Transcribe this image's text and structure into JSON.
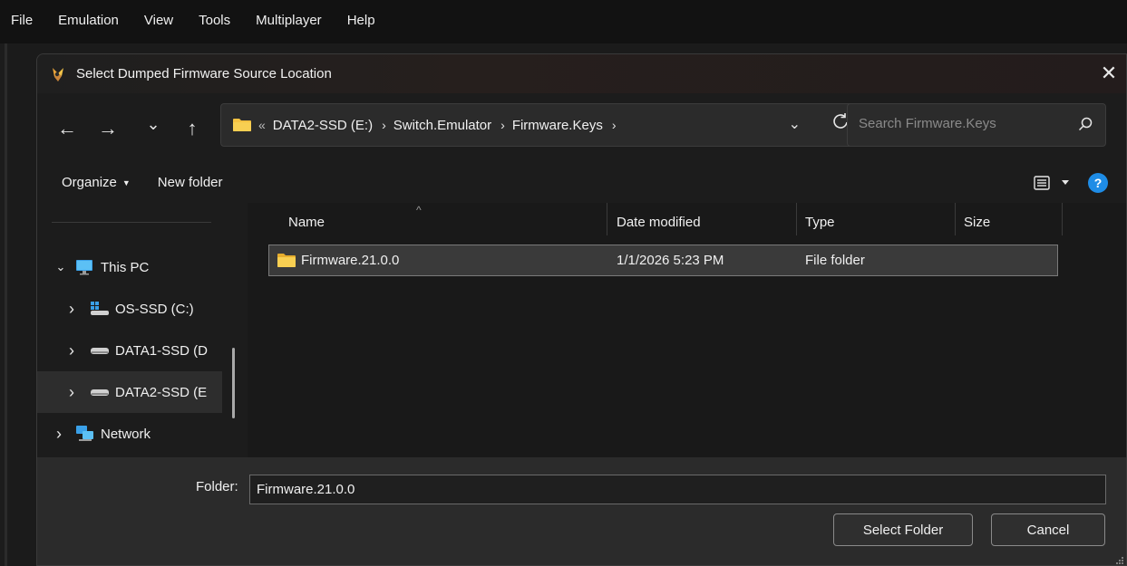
{
  "menubar": {
    "items": [
      "File",
      "Emulation",
      "View",
      "Tools",
      "Multiplayer",
      "Help"
    ]
  },
  "dialog": {
    "title": "Select Dumped Firmware Source Location",
    "close_glyph": "✕"
  },
  "nav": {
    "back_glyph": "←",
    "forward_glyph": "→",
    "recent_glyph": "⌄",
    "up_glyph": "↑",
    "address": {
      "overflow": "«",
      "crumbs": [
        "DATA2-SSD (E:)",
        "Switch.Emulator",
        "Firmware.Keys"
      ],
      "sep_glyph": "›",
      "dropdown_glyph": "⌄",
      "refresh_glyph": "C"
    },
    "search_placeholder": "Search Firmware.Keys"
  },
  "toolbar": {
    "organize_label": "Organize",
    "organize_caret": "▼",
    "new_folder_label": "New folder",
    "help_glyph": "?"
  },
  "navpane": {
    "items": [
      {
        "label": "This PC",
        "chev": "⌄"
      },
      {
        "label": "OS-SSD (C:)",
        "chev": "›"
      },
      {
        "label": "DATA1-SSD (D",
        "chev": "›"
      },
      {
        "label": "DATA2-SSD (E",
        "chev": "›"
      },
      {
        "label": "Network",
        "chev": "›"
      }
    ]
  },
  "filelist": {
    "columns": [
      "Name",
      "Date modified",
      "Type",
      "Size"
    ],
    "sort_glyph": "^",
    "rows": [
      {
        "name": "Firmware.21.0.0",
        "date": "1/1/2026 5:23 PM",
        "type": "File folder",
        "size": ""
      }
    ]
  },
  "footer": {
    "folder_label": "Folder:",
    "folder_value": "Firmware.21.0.0",
    "select_label": "Select Folder",
    "cancel_label": "Cancel"
  },
  "colors": {
    "accent": "#1e8ce6",
    "folder": "#f5c242",
    "dialog_bg": "#202020"
  }
}
